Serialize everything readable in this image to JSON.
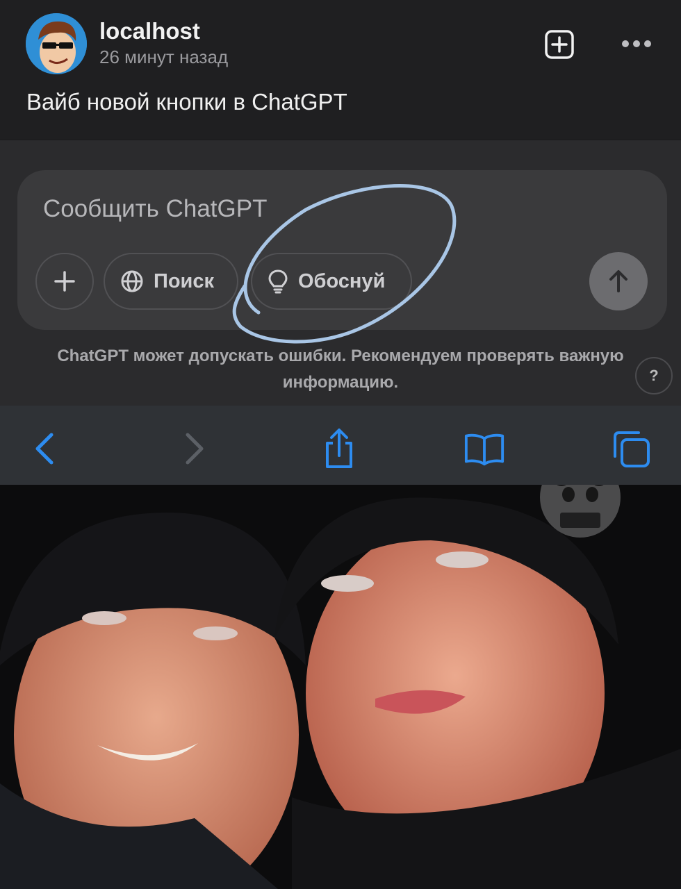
{
  "post": {
    "author": "localhost",
    "timestamp": "26 минут назад",
    "text": "Вайб новой кнопки в ChatGPT",
    "avatar_icon": "cartoon-avatar-icon",
    "add_icon": "plus-square-icon",
    "more_icon": "ellipsis-icon"
  },
  "chatgpt": {
    "placeholder": "Сообщить ChatGPT",
    "plus_icon": "plus-icon",
    "search_label": "Поиск",
    "search_icon": "globe-icon",
    "reason_label": "Обоснуй",
    "reason_icon": "lightbulb-icon",
    "send_icon": "arrow-up-icon",
    "disclaimer": "ChatGPT может допускать ошибки. Рекомендуем проверять важную информацию.",
    "help_label": "?"
  },
  "browser_toolbar": {
    "back_icon": "chevron-left-icon",
    "forward_icon": "chevron-right-icon",
    "share_icon": "share-icon",
    "bookmarks_icon": "book-icon",
    "tabs_icon": "tabs-icon",
    "accent_color": "#2d8cf0"
  },
  "photo": {
    "description_icon": "photo-of-two-people-icon",
    "watermark_icon": "panda-watermark-icon"
  },
  "colors": {
    "background": "#1f1f21",
    "composer": "#3a3a3c",
    "annotation_circle": "#a9c6e6"
  }
}
